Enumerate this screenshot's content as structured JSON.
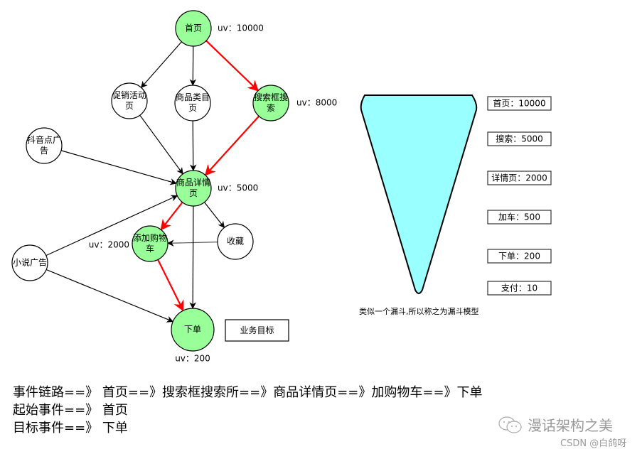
{
  "colors": {
    "highlight_node": "#99ff99",
    "plain_node": "#ffffff",
    "highlight_edge": "#ff0000",
    "normal_edge": "#000000",
    "funnel_fill": "#99ffff",
    "watermark": "#9a9a9a"
  },
  "flow": {
    "nodes": [
      {
        "id": "home",
        "lines": [
          "首页"
        ],
        "highlight": true,
        "uv": "uv：10000"
      },
      {
        "id": "promo",
        "lines": [
          "促销活动",
          "页"
        ],
        "highlight": false
      },
      {
        "id": "category",
        "lines": [
          "商品类目",
          "页"
        ],
        "highlight": false
      },
      {
        "id": "search",
        "lines": [
          "搜索框搜",
          "索"
        ],
        "highlight": true,
        "uv": "uv：8000"
      },
      {
        "id": "douyin",
        "lines": [
          "抖音点广",
          "告"
        ],
        "highlight": false
      },
      {
        "id": "detail",
        "lines": [
          "商品详情",
          "页"
        ],
        "highlight": true,
        "uv": "uv：5000"
      },
      {
        "id": "cart",
        "lines": [
          "添加购物",
          "车"
        ],
        "highlight": true,
        "uv": "uv：2000"
      },
      {
        "id": "favorite",
        "lines": [
          "收藏"
        ],
        "highlight": false
      },
      {
        "id": "novel",
        "lines": [
          "小说广告"
        ],
        "highlight": false
      },
      {
        "id": "order",
        "lines": [
          "下单"
        ],
        "highlight": true,
        "uv": "uv：200"
      }
    ],
    "edges": [
      {
        "from": "home",
        "to": "promo",
        "highlight": false
      },
      {
        "from": "home",
        "to": "category",
        "highlight": false
      },
      {
        "from": "home",
        "to": "search",
        "highlight": true
      },
      {
        "from": "promo",
        "to": "detail",
        "highlight": false
      },
      {
        "from": "category",
        "to": "detail",
        "highlight": false
      },
      {
        "from": "search",
        "to": "detail",
        "highlight": true
      },
      {
        "from": "douyin",
        "to": "detail",
        "highlight": false
      },
      {
        "from": "novel",
        "to": "detail",
        "highlight": false
      },
      {
        "from": "detail",
        "to": "cart",
        "highlight": true
      },
      {
        "from": "detail",
        "to": "favorite",
        "highlight": false
      },
      {
        "from": "favorite",
        "to": "cart",
        "highlight": false
      },
      {
        "from": "detail",
        "to": "order",
        "highlight": false
      },
      {
        "from": "cart",
        "to": "order",
        "highlight": true
      },
      {
        "from": "novel",
        "to": "order",
        "highlight": false
      }
    ],
    "goal_label": "业务目标"
  },
  "funnel": {
    "stages": [
      {
        "label": "首页：10000"
      },
      {
        "label": "搜索：5000"
      },
      {
        "label": "详情页：2000"
      },
      {
        "label": "加车：500"
      },
      {
        "label": "下单：200"
      },
      {
        "label": "支付：10"
      }
    ],
    "caption": "类似一个漏斗,所以称之为漏斗模型"
  },
  "summary": {
    "lines": [
      "事件链路==》 首页==》搜索框搜索所==》商品详情页==》加购物车==》下单",
      "起始事件==》 首页",
      "目标事件==》 下单"
    ]
  },
  "watermark": {
    "brand": "漫话架构之美",
    "credit": "CSDN @白鸽呀"
  }
}
